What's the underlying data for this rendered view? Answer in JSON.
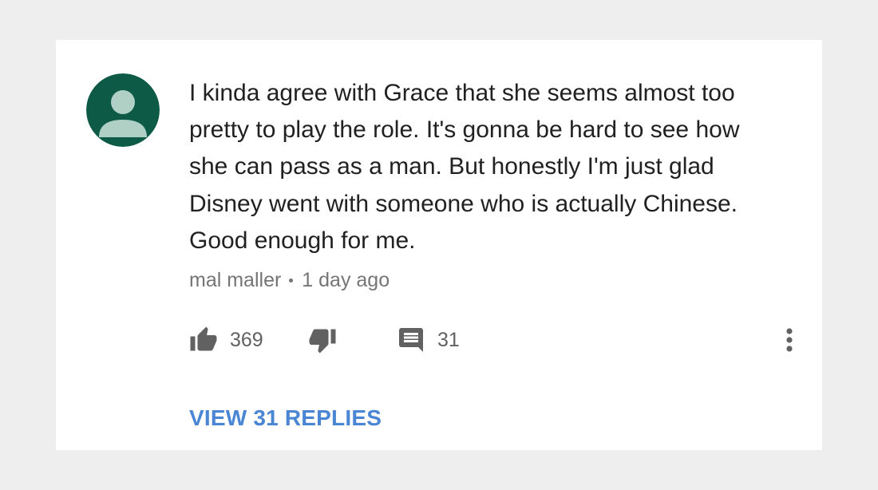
{
  "comment": {
    "text": "I kinda agree with Grace that she seems almost too\npretty to play the role. It's gonna be hard to see how\nshe can pass as a man. But honestly I'm just glad\nDisney went with someone who is actually Chinese.\nGood enough for me.",
    "author": "mal maller",
    "timestamp": "1 day ago",
    "avatar_icon": "default-user-avatar-icon",
    "avatar_color": "#0d5a46",
    "avatar_figure_color": "#b0d0c6"
  },
  "actions": {
    "like_icon": "thumbs-up-icon",
    "like_count": "369",
    "dislike_icon": "thumbs-down-icon",
    "reply_icon": "comment-icon",
    "reply_count": "31",
    "more_icon": "more-vertical-icon",
    "icon_color": "#616161"
  },
  "replies": {
    "label": "VIEW 31 REPLIES",
    "color": "#4a86d4"
  }
}
